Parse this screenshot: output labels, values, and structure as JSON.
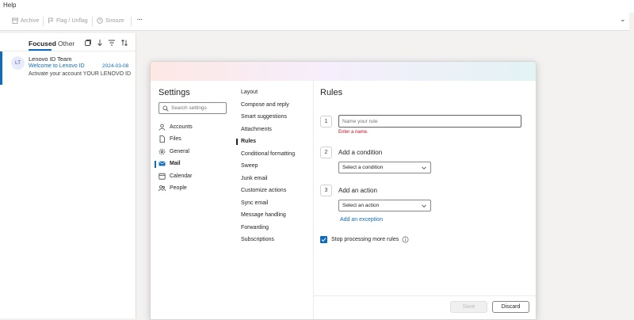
{
  "app": {
    "help_menu": "Help"
  },
  "toolbar": {
    "archive": "Archive",
    "flag": "Flag / Unflag",
    "snooze": "Snooze",
    "more": "···",
    "expand": "⌄"
  },
  "mail_list": {
    "tabs": {
      "focused": "Focused",
      "other": "Other"
    },
    "items": [
      {
        "initials": "LT",
        "sender": "Lenovo ID Team",
        "subject": "Welcome to Lenovo ID",
        "date": "2024-03-08",
        "preview": "Activate your account YOUR LENOVO ID"
      }
    ]
  },
  "settings": {
    "title": "Settings",
    "search_placeholder": "Search settings",
    "nav": [
      {
        "label": "Accounts",
        "icon": "person-icon"
      },
      {
        "label": "Files",
        "icon": "file-icon"
      },
      {
        "label": "General",
        "icon": "gear-icon"
      },
      {
        "label": "Mail",
        "icon": "mail-icon",
        "active": true
      },
      {
        "label": "Calendar",
        "icon": "calendar-icon"
      },
      {
        "label": "People",
        "icon": "people-icon"
      }
    ],
    "mail_sections": [
      "Layout",
      "Compose and reply",
      "Smart suggestions",
      "Attachments",
      "Rules",
      "Conditional formatting",
      "Sweep",
      "Junk email",
      "Customize actions",
      "Sync email",
      "Message handling",
      "Forwarding",
      "Subscriptions"
    ]
  },
  "rules": {
    "title": "Rules",
    "steps": [
      "1",
      "2",
      "3"
    ],
    "name_placeholder": "Name your rule",
    "name_error": "Enter a name.",
    "condition_label": "Add a condition",
    "condition_select": "Select a condition",
    "action_label": "Add an action",
    "action_select": "Select an action",
    "add_exception": "Add an exception",
    "stop_processing_label": "Stop processing more rules",
    "stop_processing_checked": true,
    "save_label": "Save",
    "discard_label": "Discard"
  },
  "colors": {
    "accent": "#0f6cbd",
    "error": "#c50f1f",
    "text": "#242424"
  }
}
